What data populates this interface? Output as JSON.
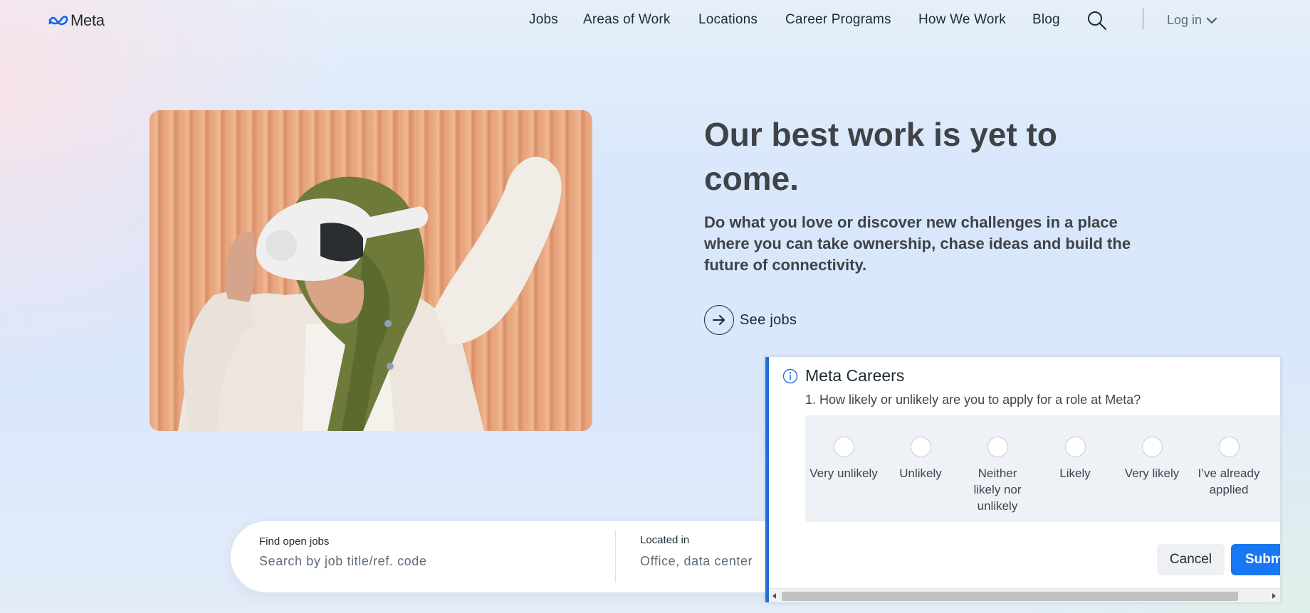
{
  "header": {
    "logo_text": "Meta",
    "nav": [
      {
        "label": "Jobs"
      },
      {
        "label": "Areas of Work"
      },
      {
        "label": "Locations"
      },
      {
        "label": "Career Programs"
      },
      {
        "label": "How We Work"
      },
      {
        "label": "Blog"
      }
    ],
    "search_icon": "search-icon",
    "login_label": "Log in",
    "login_icon": "chevron-down-icon"
  },
  "hero": {
    "image_alt": "person wearing a VR headset and green headscarf",
    "title": "Our best work is yet to come.",
    "subtitle": "Do what you love or discover new challenges in a place where you can take ownership, chase ideas and build the future of connectivity.",
    "cta_label": "See jobs",
    "cta_icon": "arrow-right-icon"
  },
  "job_search": {
    "find_label": "Find open jobs",
    "find_placeholder": "Search by job title/ref. code",
    "location_label": "Located in",
    "location_placeholder": "Office, data center"
  },
  "survey": {
    "title": "Meta Careers",
    "info_icon": "info-icon",
    "question": "1. How likely or unlikely are you to apply for a role at Meta?",
    "options": [
      {
        "label": "Very unlikely"
      },
      {
        "label": "Unlikely"
      },
      {
        "label": "Neither likely nor unlikely"
      },
      {
        "label": "Likely"
      },
      {
        "label": "Very likely"
      },
      {
        "label": "I’ve already applied"
      }
    ],
    "cancel_label": "Cancel",
    "submit_label": "Submit"
  },
  "colors": {
    "accent": "#1877f2",
    "survey_border": "#1f6fd9",
    "text_dark": "#1c2b33",
    "heading": "#3f4347"
  }
}
